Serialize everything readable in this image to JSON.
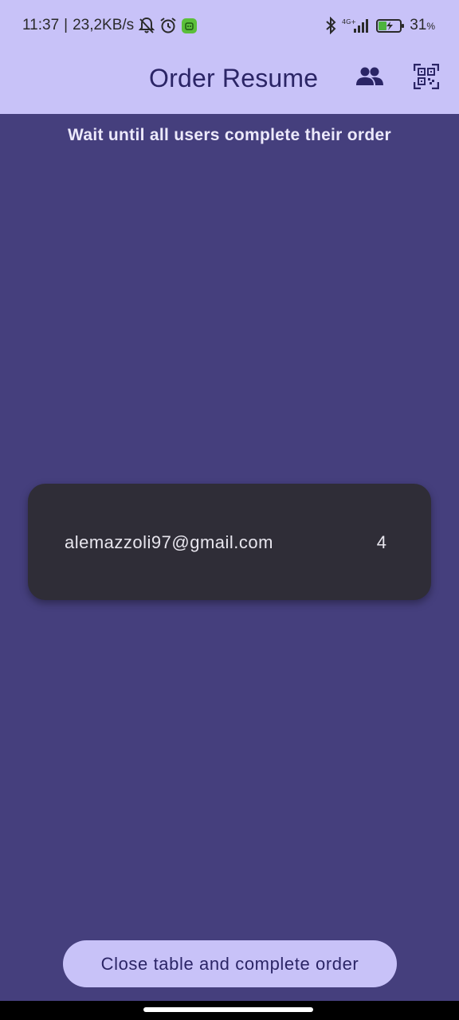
{
  "status_bar": {
    "time": "11:37",
    "separator": "|",
    "network_speed": "23,2KB/s",
    "network_type": "4G+",
    "battery_percent": "31",
    "battery_unit": "%",
    "icons": [
      "bell-off-icon",
      "alarm-icon",
      "app-badge-icon",
      "bluetooth-icon",
      "signal-icon",
      "battery-charging-icon"
    ]
  },
  "app_bar": {
    "title": "Order Resume",
    "actions": [
      "users-icon",
      "qr-code-icon"
    ]
  },
  "main": {
    "info": "Wait until all users complete their order",
    "users": [
      {
        "email": "alemazzoli97@gmail.com",
        "count": "4"
      }
    ]
  },
  "footer": {
    "close_label": "Close table and complete order"
  },
  "colors": {
    "background": "#453F7D",
    "app_bar": "#C8C2F8",
    "card": "#2F2D37",
    "title": "#2B2566",
    "button": "#C8C2F8"
  }
}
